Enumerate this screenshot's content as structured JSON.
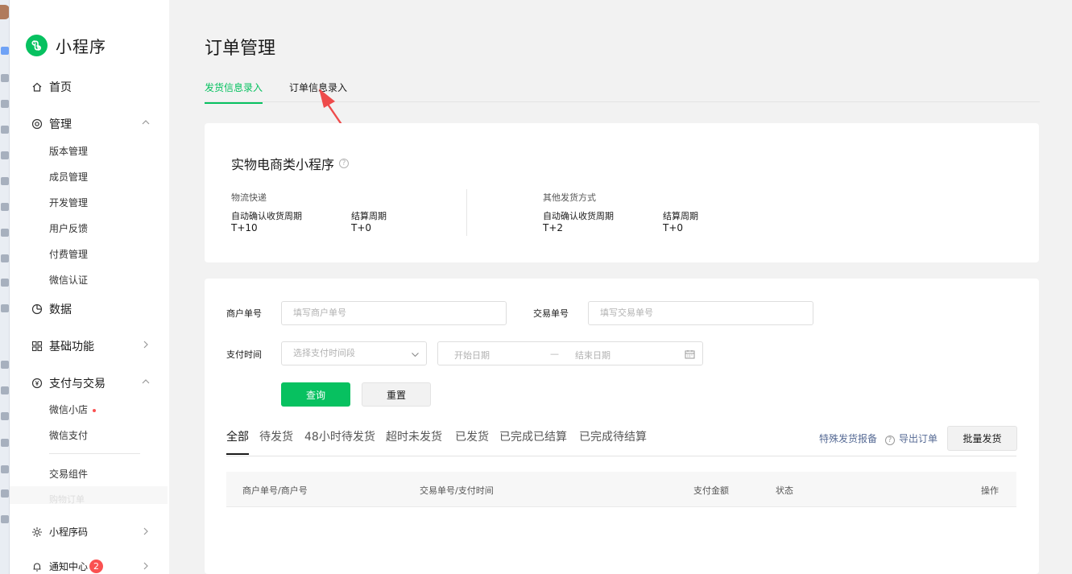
{
  "app": {
    "name": "小程序",
    "brand_color": "#07c160"
  },
  "sidebar": {
    "items": [
      {
        "label": "首页",
        "icon": "home-icon"
      },
      {
        "label": "管理",
        "icon": "manage-icon",
        "expanded": true,
        "children": [
          "版本管理",
          "成员管理",
          "开发管理",
          "用户反馈",
          "付费管理",
          "微信认证"
        ]
      },
      {
        "label": "数据",
        "icon": "chart-icon"
      },
      {
        "label": "基础功能",
        "icon": "grid-icon",
        "expanded": false
      },
      {
        "label": "支付与交易",
        "icon": "yen-icon",
        "expanded": true,
        "children": [
          "微信小店",
          "微信支付",
          "交易组件"
        ]
      },
      {
        "label": "小程序码",
        "icon": "sun-icon",
        "expanded": false
      },
      {
        "label": "通知中心",
        "icon": "bell-icon",
        "badge": "2",
        "expanded": false
      }
    ],
    "faded_item": "购物订单"
  },
  "page": {
    "title": "订单管理",
    "tabs": [
      {
        "label": "发货信息录入",
        "active": true
      },
      {
        "label": "订单信息录入",
        "active": false
      }
    ]
  },
  "settlement": {
    "title": "实物电商类小程序",
    "groups": [
      {
        "name": "物流快递",
        "confirm_label": "自动确认收货周期",
        "confirm_value": "T+10",
        "settle_label": "结算周期",
        "settle_value": "T+0"
      },
      {
        "name": "其他发货方式",
        "confirm_label": "自动确认收货周期",
        "confirm_value": "T+2",
        "settle_label": "结算周期",
        "settle_value": "T+0"
      }
    ]
  },
  "filters": {
    "merchant_no_label": "商户单号",
    "merchant_no_placeholder": "填写商户单号",
    "trade_no_label": "交易单号",
    "trade_no_placeholder": "填写交易单号",
    "pay_time_label": "支付时间",
    "pay_time_select": "选择支付时间段",
    "start_date": "开始日期",
    "date_sep": "—",
    "end_date": "结束日期",
    "query_button": "查询",
    "reset_button": "重置"
  },
  "order_tabs": [
    "全部",
    "待发货",
    "48小时待发货",
    "超时未发货",
    "已发货",
    "已完成已结算",
    "已完成待结算"
  ],
  "actions": {
    "special_report": "特殊发货报备",
    "export": "导出订单",
    "batch_ship": "批量发货"
  },
  "table": {
    "columns": [
      "商户单号/商户号",
      "交易单号/支付时间",
      "支付金额",
      "状态",
      "操作"
    ]
  }
}
